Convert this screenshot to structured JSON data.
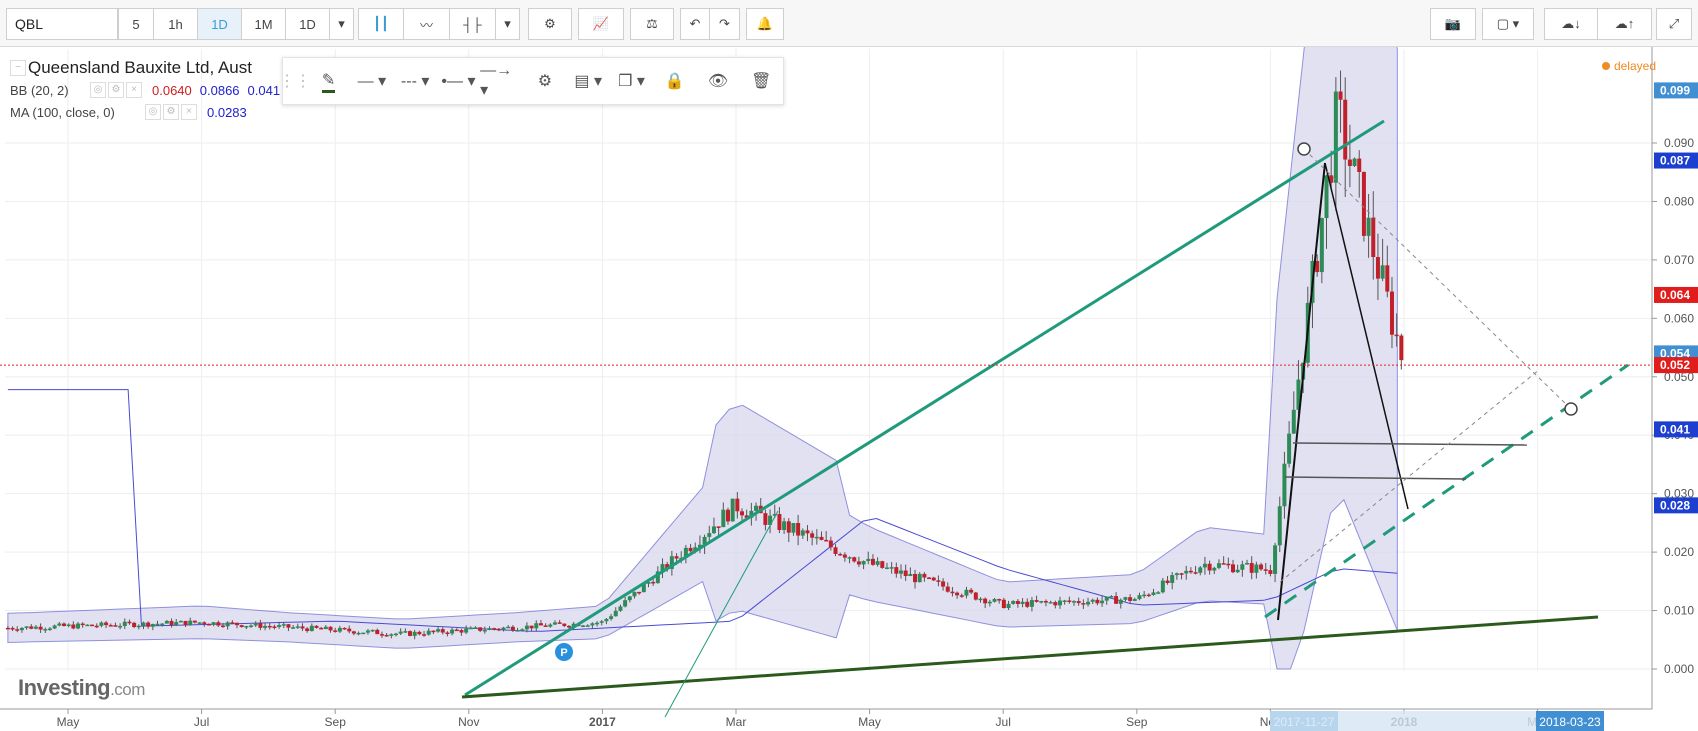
{
  "toolbar": {
    "symbol": "QBL",
    "intervals": [
      "5",
      "1h",
      "1D",
      "1M",
      "1D"
    ],
    "active_interval": "1D",
    "icons": [
      "candles-icon",
      "line-chart-icon",
      "bar-chart-icon",
      "dropdown-icon",
      "settings-icon",
      "indicators-icon",
      "compare-icon",
      "undo-icon",
      "redo-icon",
      "alert-icon"
    ],
    "right_icons": [
      "camera-icon",
      "color-box-icon",
      "cloud-download-icon",
      "cloud-upload-icon",
      "fullscreen-icon"
    ]
  },
  "legend": {
    "title": "Queensland Bauxite Ltd, Aust",
    "bb": {
      "name": "BB (20, 2)",
      "v1": "0.0640",
      "v2": "0.0866",
      "v3": "0.041"
    },
    "ma": {
      "name": "MA (100, close, 0)",
      "v1": "0.0283"
    }
  },
  "drawing_toolbar": [
    "pencil-icon",
    "line-style-icon",
    "dash-style-icon",
    "line-end-left-icon",
    "line-end-right-icon",
    "gear-icon",
    "layers-icon",
    "copy-icon",
    "lock-icon",
    "eye-icon",
    "trash-icon"
  ],
  "status": {
    "delayed": "delayed"
  },
  "watermark": {
    "brand": "Investing",
    "suffix": ".com"
  },
  "colors": {
    "up": "#2e8b57",
    "down": "#c0202a",
    "bb_fill": "#d7d8ee",
    "bb_line": "#6b6bd4",
    "ma_line": "#4a4ad4",
    "trend_green": "#1f9a7a",
    "support": "#2c5a1c",
    "price_line": "#e02020"
  },
  "chart_data": {
    "type": "candlestick",
    "symbol": "QBL",
    "y_ticks": [
      "0.000",
      "0.010",
      "0.020",
      "0.030",
      "0.040",
      "0.050",
      "0.060",
      "0.070",
      "0.080",
      "0.090"
    ],
    "ylim": [
      0.0,
      0.1
    ],
    "x_ticks": [
      "May",
      "Jul",
      "Sep",
      "Nov",
      "2017",
      "Mar",
      "May",
      "Jul",
      "Sep",
      "Nov",
      "2018",
      "Mar"
    ],
    "x_highlights": [
      "2017-11-27",
      "2018-03-23"
    ],
    "price_labels": [
      {
        "value": 0.099,
        "text": "0.099",
        "style": "blue-light"
      },
      {
        "value": 0.087,
        "text": "0.087",
        "style": "blue"
      },
      {
        "value": 0.064,
        "text": "0.064",
        "style": "red"
      },
      {
        "value": 0.054,
        "text": "0.054",
        "style": "blue-light"
      },
      {
        "value": 0.052,
        "text": "0.052",
        "style": "red"
      },
      {
        "value": 0.041,
        "text": "0.041",
        "style": "blue"
      },
      {
        "value": 0.028,
        "text": "0.028",
        "style": "blue"
      }
    ],
    "last_price": 0.052,
    "marker": {
      "text": "P"
    },
    "ohlc_sampled": [
      {
        "date": "2016-04",
        "close": 0.007
      },
      {
        "date": "2016-07",
        "close": 0.008
      },
      {
        "date": "2016-10",
        "close": 0.006
      },
      {
        "date": "2017-01",
        "close": 0.008
      },
      {
        "date": "2017-03",
        "close": 0.028
      },
      {
        "date": "2017-05",
        "close": 0.018
      },
      {
        "date": "2017-07",
        "close": 0.011
      },
      {
        "date": "2017-09",
        "close": 0.012
      },
      {
        "date": "2017-10",
        "close": 0.018
      },
      {
        "date": "2017-11",
        "close": 0.017
      },
      {
        "date": "2017-12",
        "close": 0.095
      },
      {
        "date": "2018-01",
        "close": 0.052
      }
    ]
  }
}
